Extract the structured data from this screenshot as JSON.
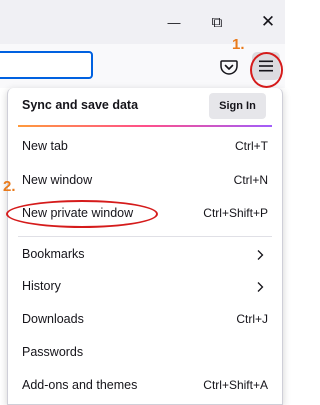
{
  "window": {
    "minimize_label": "—",
    "maximize_label": "⧉",
    "close_label": "✕"
  },
  "annotations": {
    "step1": "1.",
    "step2": "2."
  },
  "menu": {
    "sync_title": "Sync and save data",
    "sign_in_label": "Sign In",
    "items": [
      {
        "label": "New tab",
        "shortcut": "Ctrl+T"
      },
      {
        "label": "New window",
        "shortcut": "Ctrl+N"
      },
      {
        "label": "New private window",
        "shortcut": "Ctrl+Shift+P"
      },
      {
        "label": "Bookmarks",
        "shortcut": ""
      },
      {
        "label": "History",
        "shortcut": ""
      },
      {
        "label": "Downloads",
        "shortcut": "Ctrl+J"
      },
      {
        "label": "Passwords",
        "shortcut": ""
      },
      {
        "label": "Add-ons and themes",
        "shortcut": "Ctrl+Shift+A"
      }
    ]
  },
  "icons": {
    "pocket": "pocket-icon",
    "menu": "hamburger-menu-icon",
    "submenu": "chevron-right-icon"
  },
  "colors": {
    "annotation_orange": "#e97a1b",
    "highlight_red": "#d51b1b",
    "urlbar_focus": "#0061e0"
  }
}
